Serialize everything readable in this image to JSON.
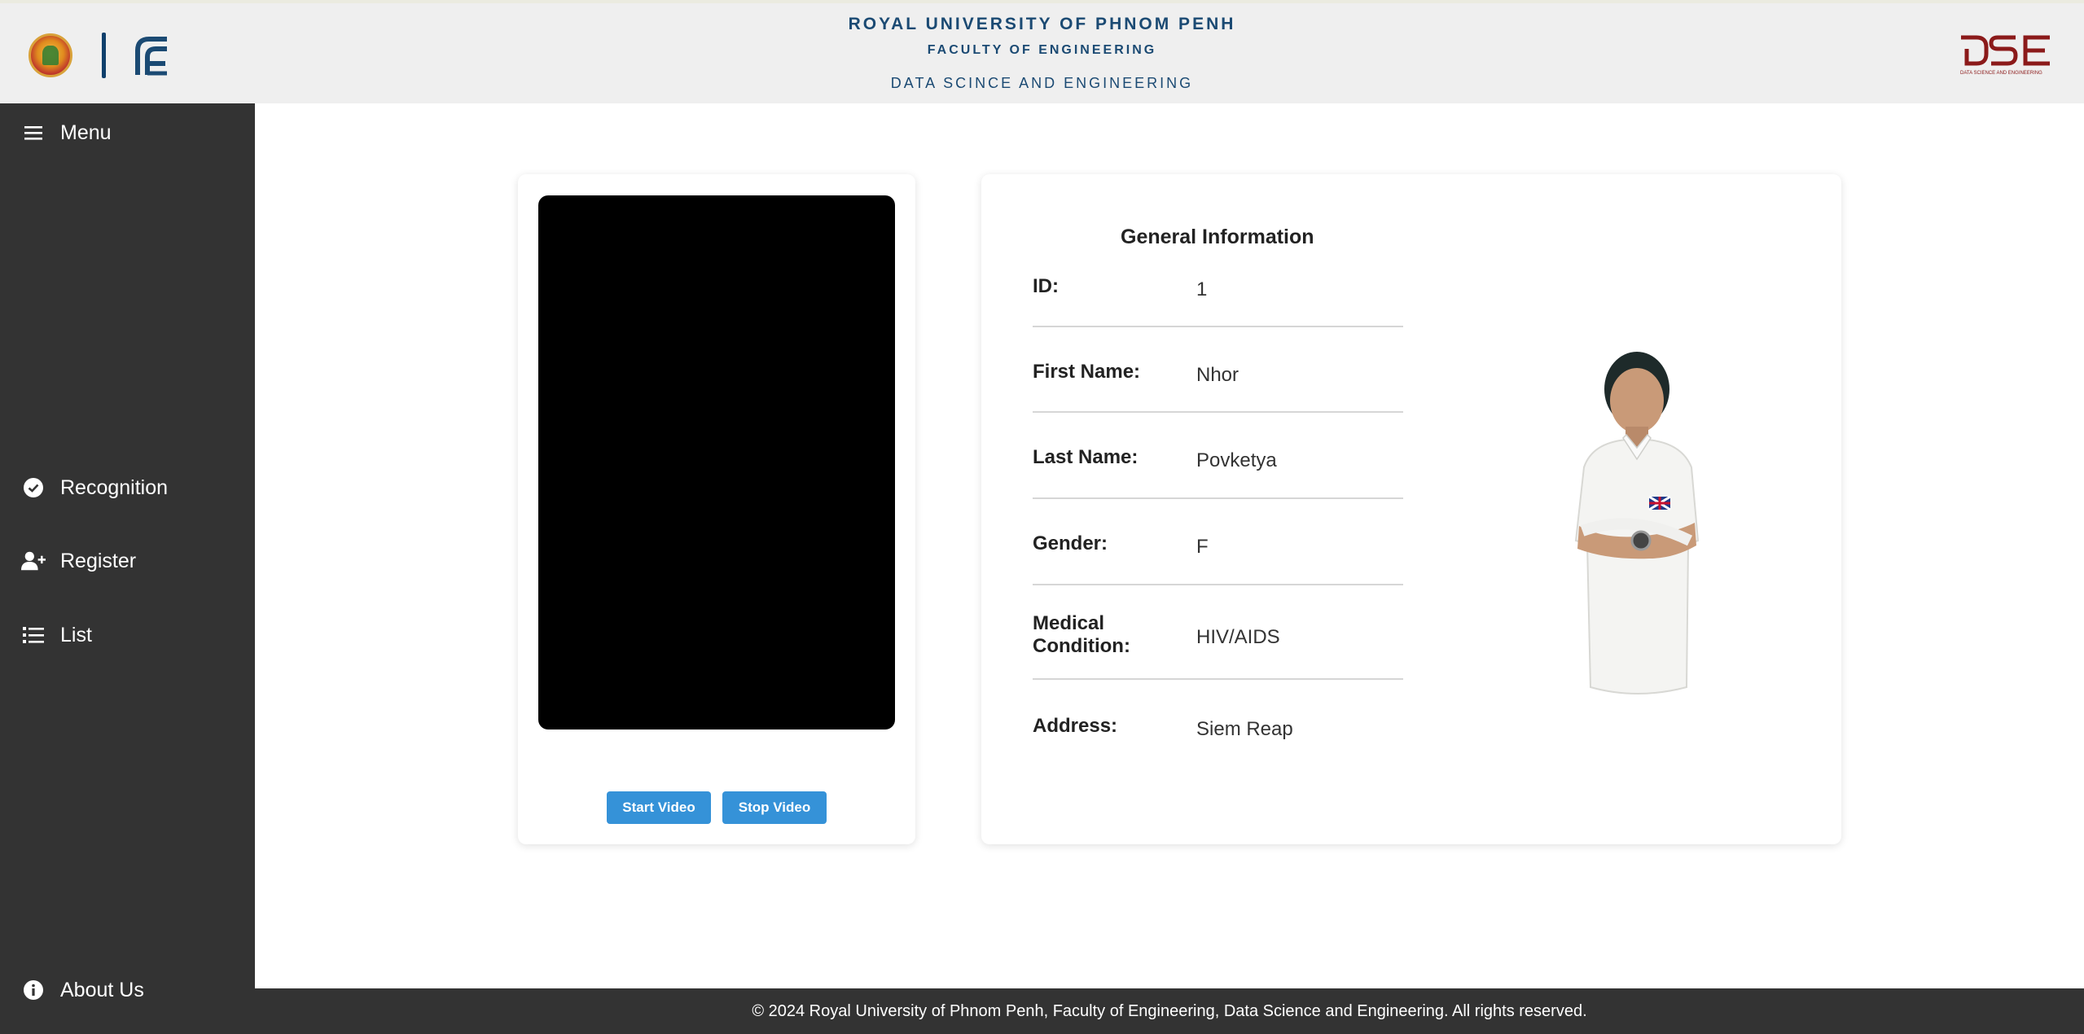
{
  "header": {
    "title": "ROYAL UNIVERSITY OF PHNOM PENH",
    "subtitle": "FACULTY OF ENGINEERING",
    "department": "DATA SCINCE AND ENGINEERING",
    "left_logo_icon": "rupp-seal-logo",
    "fe_logo_icon": "fe-logo",
    "right_logo_icon": "dse-logo",
    "dse_logo_caption": "DATA SCIENCE AND ENGINEERING"
  },
  "sidebar": {
    "menu": {
      "label": "Menu",
      "icon": "hamburger-icon"
    },
    "items": [
      {
        "label": "Recognition",
        "icon": "check-circle-icon"
      },
      {
        "label": "Register",
        "icon": "user-plus-icon"
      },
      {
        "label": "List",
        "icon": "list-icon"
      }
    ],
    "about": {
      "label": "About Us",
      "icon": "info-circle-icon"
    }
  },
  "video": {
    "start_label": "Start Video",
    "stop_label": "Stop Video"
  },
  "info": {
    "title": "General Information",
    "fields": [
      {
        "label": "ID:",
        "value": "1"
      },
      {
        "label": "First Name:",
        "value": "Nhor"
      },
      {
        "label": "Last Name:",
        "value": "Povketya"
      },
      {
        "label": "Gender:",
        "value": "F"
      },
      {
        "label": "Medical Condition:",
        "value": "HIV/AIDS"
      },
      {
        "label": "Address:",
        "value": "Siem Reap"
      }
    ]
  },
  "footer": {
    "text": "© 2024 Royal University of Phnom Penh, Faculty of Engineering, Data Science and Engineering. All rights reserved."
  },
  "colors": {
    "sidebar_bg": "#333333",
    "header_bg": "#efefef",
    "title_blue": "#1b4a73",
    "button_blue": "#3592d8",
    "dse_red": "#8b1a1a"
  }
}
